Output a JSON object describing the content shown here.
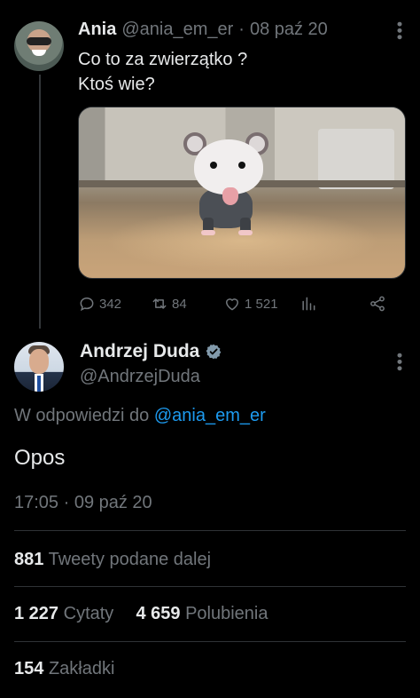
{
  "parent_tweet": {
    "name": "Ania",
    "handle": "@ania_em_er",
    "separator": "·",
    "date": "08 paź 20",
    "text_line1": "Co to za zwierzątko ?",
    "text_line2": "Ktoś wie?",
    "actions": {
      "replies": "342",
      "retweets": "84",
      "likes": "1 521"
    }
  },
  "main_tweet": {
    "name": "Andrzej Duda",
    "handle": "@AndrzejDuda",
    "reply_prefix": "W odpowiedzi do",
    "reply_handle": "@ania_em_er",
    "text": "Opos",
    "timestamp": "17:05 · 09 paź 20",
    "stats": {
      "retweets_count": "881",
      "retweets_label": "Tweety podane dalej",
      "quotes_count": "1 227",
      "quotes_label": "Cytaty",
      "likes_count": "4 659",
      "likes_label": "Polubienia",
      "bookmarks_count": "154",
      "bookmarks_label": "Zakładki"
    }
  },
  "colors": {
    "background": "#000000",
    "text": "#e7e9ea",
    "muted": "#71767b",
    "link": "#1d9bf0",
    "divider": "#2f3336"
  },
  "icons": {
    "reply": "speech-bubble-icon",
    "retweet": "retweet-icon",
    "like": "heart-icon",
    "views": "bar-chart-icon",
    "share": "share-icon",
    "verified": "verified-badge-icon",
    "more": "more-icon"
  }
}
